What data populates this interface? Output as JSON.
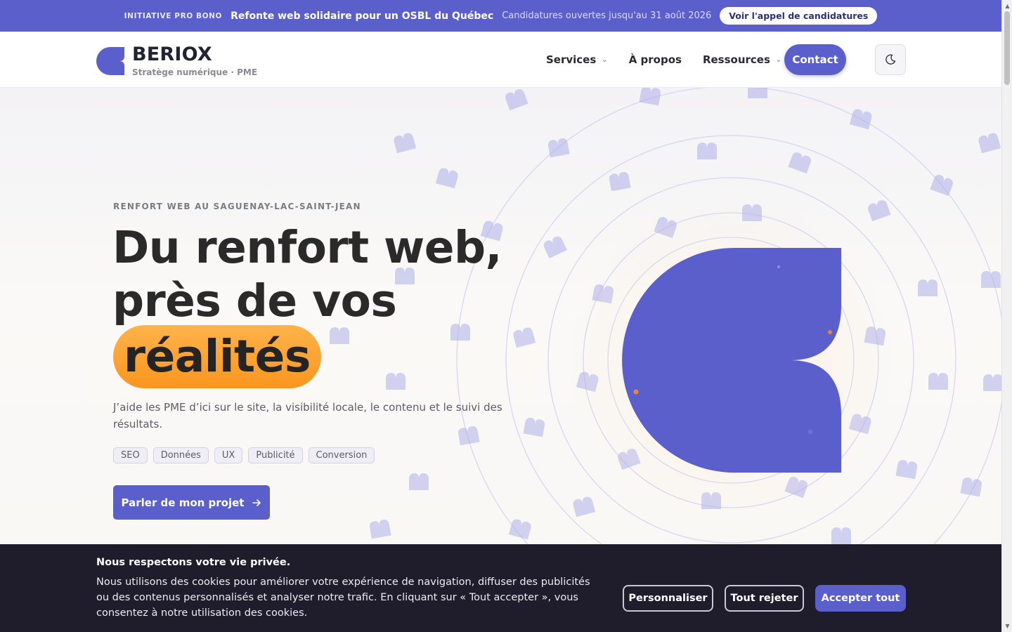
{
  "announcement": {
    "tag": "INITIATIVE PRO BONO",
    "title": "Refonte web solidaire pour un OSBL du Québec",
    "subtitle": "Candidatures ouvertes jusqu'au 31 août 2026",
    "cta": "Voir l'appel de candidatures"
  },
  "header": {
    "brand": "BERIOX",
    "tagline": "Stratège numérique · PME",
    "nav": [
      {
        "label": "Services",
        "has_dropdown": true
      },
      {
        "label": "À propos",
        "has_dropdown": false
      },
      {
        "label": "Ressources",
        "has_dropdown": true
      }
    ],
    "contact": "Contact",
    "theme_toggle_icon": "moon-icon"
  },
  "hero": {
    "eyebrow": "RENFORT WEB AU SAGUENAY-LAC-SAINT-JEAN",
    "headline_line1": "Du renfort web,",
    "headline_line2": "près de vos",
    "highlight": "réalités",
    "lead": "J’aide les PME d’ici sur le site, la visibilité locale, le contenu et le suivi des résultats.",
    "tags": [
      "SEO",
      "Données",
      "UX",
      "Publicité",
      "Conversion"
    ],
    "cta": "Parler de mon projet"
  },
  "cookie": {
    "title": "Nous respectons votre vie privée.",
    "text": "Nous utilisons des cookies pour améliorer votre expérience de navigation, diffuser des publicités ou des contenus personnalisés et analyser notre trafic. En cliquant sur « Tout accepter », vous consentez à notre utilisation des cookies.",
    "customize": "Personnaliser",
    "reject": "Tout rejeter",
    "accept": "Accepter tout"
  },
  "colors": {
    "brand": "#5b5fcb",
    "highlight": "#f9961f",
    "cookie_bg": "#1f1c2b"
  }
}
